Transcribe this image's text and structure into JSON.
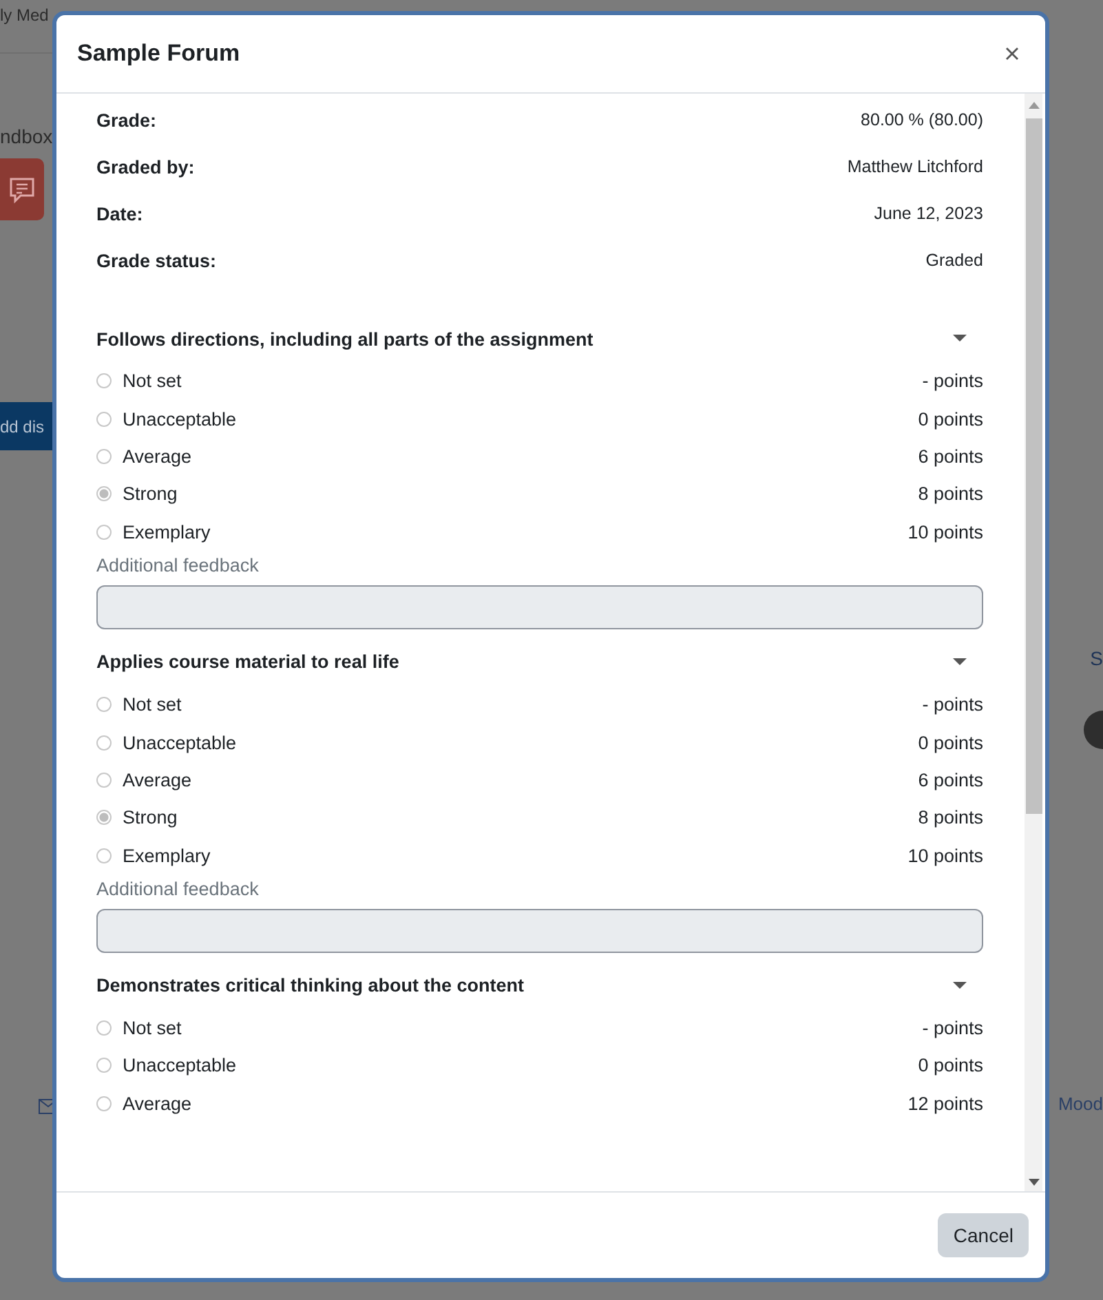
{
  "backdrop": {
    "top_link": "ly Med",
    "section_label": "ndbox",
    "add_button": "dd dis",
    "right_link": "S",
    "footer_link": "Mood"
  },
  "modal": {
    "title": "Sample Forum",
    "summary": [
      {
        "label": "Grade:",
        "value": "80.00 % (80.00)"
      },
      {
        "label": "Graded by:",
        "value": "Matthew Litchford"
      },
      {
        "label": "Date:",
        "value": "June 12, 2023"
      },
      {
        "label": "Grade status:",
        "value": "Graded"
      }
    ],
    "criteria": [
      {
        "title": "Follows directions, including all parts of the assignment",
        "feedback_label": "Additional feedback",
        "options": [
          {
            "label": "Not set",
            "points": "- points",
            "selected": false
          },
          {
            "label": "Unacceptable",
            "points": "0 points",
            "selected": false
          },
          {
            "label": "Average",
            "points": "6 points",
            "selected": false
          },
          {
            "label": "Strong",
            "points": "8 points",
            "selected": true
          },
          {
            "label": "Exemplary",
            "points": "10 points",
            "selected": false
          }
        ]
      },
      {
        "title": "Applies course material to real life",
        "feedback_label": "Additional feedback",
        "options": [
          {
            "label": "Not set",
            "points": "- points",
            "selected": false
          },
          {
            "label": "Unacceptable",
            "points": "0 points",
            "selected": false
          },
          {
            "label": "Average",
            "points": "6 points",
            "selected": false
          },
          {
            "label": "Strong",
            "points": "8 points",
            "selected": true
          },
          {
            "label": "Exemplary",
            "points": "10 points",
            "selected": false
          }
        ]
      },
      {
        "title": "Demonstrates critical thinking about the content",
        "options": [
          {
            "label": "Not set",
            "points": "- points",
            "selected": false
          },
          {
            "label": "Unacceptable",
            "points": "0 points",
            "selected": false
          },
          {
            "label": "Average",
            "points": "12 points",
            "selected": false
          }
        ]
      }
    ],
    "buttons": [
      "Cancel"
    ]
  }
}
